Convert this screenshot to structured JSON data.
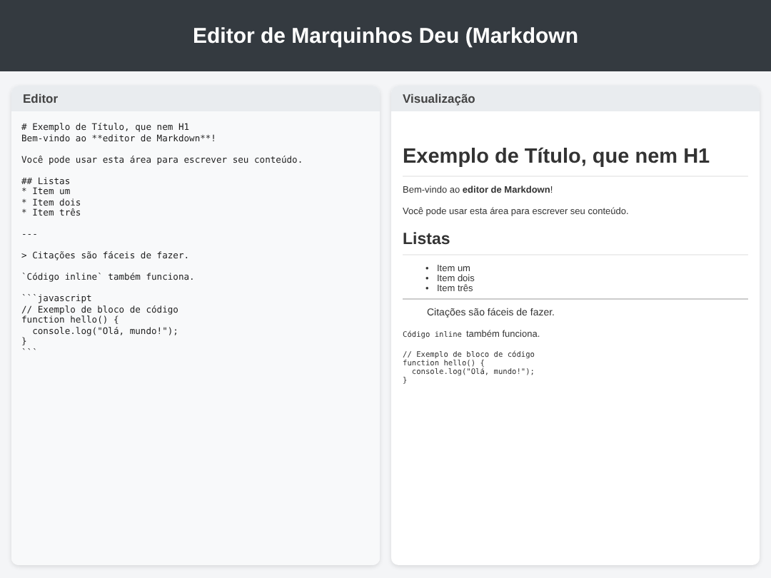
{
  "header": {
    "title": "Editor de Marquinhos Deu (Markdown"
  },
  "editor": {
    "title": "Editor",
    "value": "# Exemplo de Título, que nem H1\nBem-vindo ao **editor de Markdown**!\n\nVocê pode usar esta área para escrever seu conteúdo.\n\n## Listas\n* Item um\n* Item dois\n* Item três\n\n---\n\n> Citações são fáceis de fazer.\n\n`Código inline` também funciona.\n\n```javascript\n// Exemplo de bloco de código\nfunction hello() {\n  console.log(\"Olá, mundo!\");\n}\n```"
  },
  "preview": {
    "title": "Visualização",
    "blocks": [
      {
        "kind": "h1",
        "text": "Exemplo de Título, que nem H1"
      },
      {
        "kind": "p",
        "text": "Bem-vindo ao **editor de Markdown**!"
      },
      {
        "kind": "p",
        "text": "Você pode usar esta área para escrever seu conteúdo."
      },
      {
        "kind": "h2",
        "text": "Listas"
      },
      {
        "kind": "list",
        "marker": "•",
        "items": [
          "Item um",
          "Item dois",
          "Item três"
        ]
      },
      {
        "kind": "hr"
      },
      {
        "kind": "quote",
        "text": "Citações são fáceis de fazer."
      },
      {
        "kind": "inline_code",
        "code": "Código inline",
        "text": "também funciona."
      },
      {
        "kind": "code",
        "text": "// Exemplo de bloco de código\nfunction hello() {\n  console.log(\"Olá, mundo!\");\n}"
      }
    ]
  }
}
